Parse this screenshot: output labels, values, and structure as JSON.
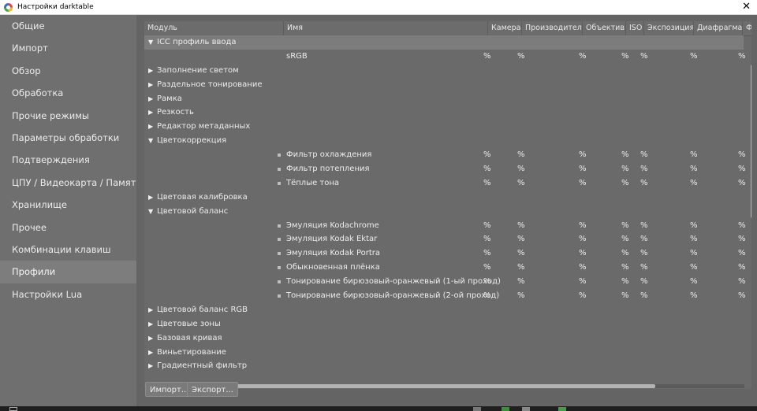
{
  "window": {
    "title": "Настройки darktable"
  },
  "sidebar": {
    "items": [
      {
        "label": "Общие",
        "active": false
      },
      {
        "label": "Импорт",
        "active": false
      },
      {
        "label": "Обзор",
        "active": false
      },
      {
        "label": "Обработка",
        "active": false
      },
      {
        "label": "Прочие режимы",
        "active": false
      },
      {
        "label": "Параметры обработки",
        "active": false
      },
      {
        "label": "Подтверждения",
        "active": false
      },
      {
        "label": "ЦПУ / Видеокарта / Память",
        "active": false
      },
      {
        "label": "Хранилище",
        "active": false
      },
      {
        "label": "Прочее",
        "active": false
      },
      {
        "label": "Комбинации клавиш",
        "active": false
      },
      {
        "label": "Профили",
        "active": true
      },
      {
        "label": "Настройки Lua",
        "active": false
      }
    ]
  },
  "table": {
    "columns": [
      "Модуль",
      "Имя",
      "Камера",
      "Производитель",
      "Объектив",
      "ISO",
      "Экспозиция",
      "Диафрагма",
      "Ф"
    ],
    "pct": "%",
    "rows": [
      {
        "type": "group",
        "label": "ICC профиль ввода",
        "expanded": true,
        "selected": true
      },
      {
        "type": "preset",
        "name": "sRGB"
      },
      {
        "type": "group",
        "label": "Заполнение светом",
        "expanded": false
      },
      {
        "type": "group",
        "label": "Раздельное тонирование",
        "expanded": false
      },
      {
        "type": "group",
        "label": "Рамка",
        "expanded": false
      },
      {
        "type": "group",
        "label": "Резкость",
        "expanded": false
      },
      {
        "type": "group",
        "label": "Редактор метаданных",
        "expanded": false
      },
      {
        "type": "group",
        "label": "Цветокоррекция",
        "expanded": true
      },
      {
        "type": "preset",
        "name": "Фильтр охлаждения",
        "bullet": true
      },
      {
        "type": "preset",
        "name": "Фильтр потепления",
        "bullet": true
      },
      {
        "type": "preset",
        "name": "Тёплые тона",
        "bullet": true
      },
      {
        "type": "group",
        "label": "Цветовая калибровка",
        "expanded": false
      },
      {
        "type": "group",
        "label": "Цветовой баланс",
        "expanded": true
      },
      {
        "type": "preset",
        "name": "Эмуляция Kodachrome",
        "bullet": true
      },
      {
        "type": "preset",
        "name": "Эмуляция Kodak Ektar",
        "bullet": true
      },
      {
        "type": "preset",
        "name": "Эмуляция Kodak Portra",
        "bullet": true
      },
      {
        "type": "preset",
        "name": "Обыкновенная плёнка",
        "bullet": true
      },
      {
        "type": "preset",
        "name": "Тонирование бирюзовый-оранжевый (1-ый проход)",
        "bullet": true
      },
      {
        "type": "preset",
        "name": "Тонирование бирюзовый-оранжевый (2-ой проход)",
        "bullet": true
      },
      {
        "type": "group",
        "label": "Цветовой баланс RGB",
        "expanded": false
      },
      {
        "type": "group",
        "label": "Цветовые зоны",
        "expanded": false
      },
      {
        "type": "group",
        "label": "Базовая кривая",
        "expanded": false
      },
      {
        "type": "group",
        "label": "Виньетирование",
        "expanded": false
      },
      {
        "type": "group",
        "label": "Градиентный фильтр",
        "expanded": false
      }
    ]
  },
  "buttons": {
    "import": "Импорт...",
    "export": "Экспорт..."
  },
  "icons": {
    "expanded": "▼",
    "collapsed": "▶",
    "close": "✕"
  },
  "colors": {
    "panel_bg": "#646464",
    "selected_row": "#7c7c7c",
    "sidebar_active": "#7d7d7d"
  }
}
